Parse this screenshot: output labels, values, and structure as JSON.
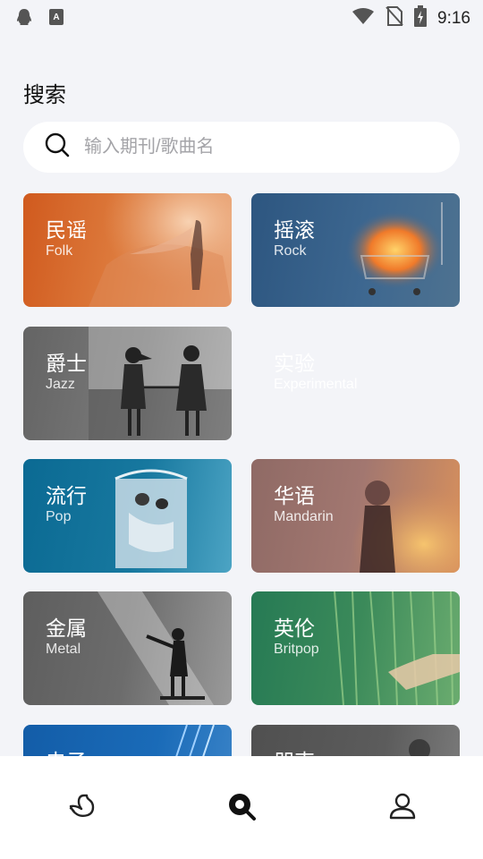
{
  "status_bar": {
    "time": "9:16",
    "icons": [
      "qq-icon",
      "keyboard-a-icon",
      "wifi-icon",
      "no-sim-icon",
      "battery-charging-icon"
    ]
  },
  "page": {
    "title": "搜索"
  },
  "search": {
    "placeholder": "输入期刊/歌曲名",
    "value": ""
  },
  "categories": [
    {
      "zh": "民谣",
      "en": "Folk"
    },
    {
      "zh": "摇滚",
      "en": "Rock"
    },
    {
      "zh": "爵士",
      "en": "Jazz"
    },
    {
      "zh": "实验",
      "en": "Experimental"
    },
    {
      "zh": "流行",
      "en": "Pop"
    },
    {
      "zh": "华语",
      "en": "Mandarin"
    },
    {
      "zh": "金属",
      "en": "Metal"
    },
    {
      "zh": "英伦",
      "en": "Britpop"
    },
    {
      "zh": "电子",
      "en": ""
    },
    {
      "zh": "朋克",
      "en": ""
    }
  ],
  "tabbar": {
    "items": [
      "swan-logo-icon",
      "search-icon",
      "profile-icon"
    ],
    "active": "search",
    "active_color": "#111111",
    "inactive_color": "#222222"
  }
}
